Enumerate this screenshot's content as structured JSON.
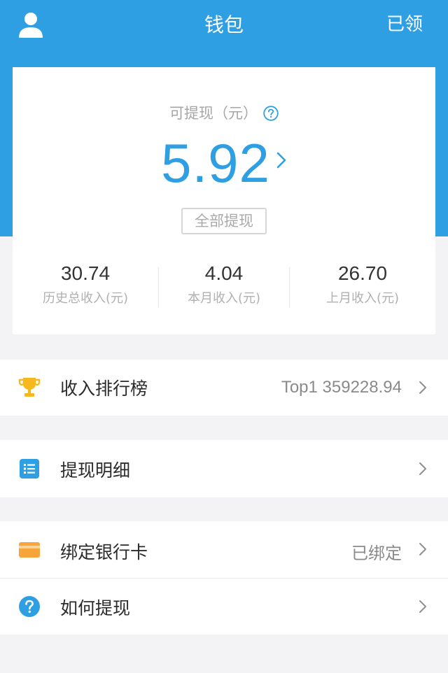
{
  "header": {
    "title": "钱包",
    "right_label": "已领",
    "user_icon": "user-icon",
    "bg_color": "#2f9fe3"
  },
  "balance": {
    "label": "可提现（元）",
    "help_icon": "question-circle-icon",
    "amount": "5.92",
    "amount_color": "#2f9fe3",
    "withdraw_all_label": "全部提现"
  },
  "stats": [
    {
      "value": "30.74",
      "label": "历史总收入(元)"
    },
    {
      "value": "4.04",
      "label": "本月收入(元)"
    },
    {
      "value": "26.70",
      "label": "上月收入(元)"
    }
  ],
  "menu": {
    "ranking": {
      "icon": "trophy-icon",
      "label": "收入排行榜",
      "value": "Top1 359228.94"
    },
    "withdraw_detail": {
      "icon": "list-icon",
      "label": "提现明细"
    },
    "bank_card": {
      "icon": "bank-card-icon",
      "label": "绑定银行卡",
      "value": "已绑定"
    },
    "how_to_withdraw": {
      "icon": "help-icon",
      "label": "如何提现"
    }
  }
}
